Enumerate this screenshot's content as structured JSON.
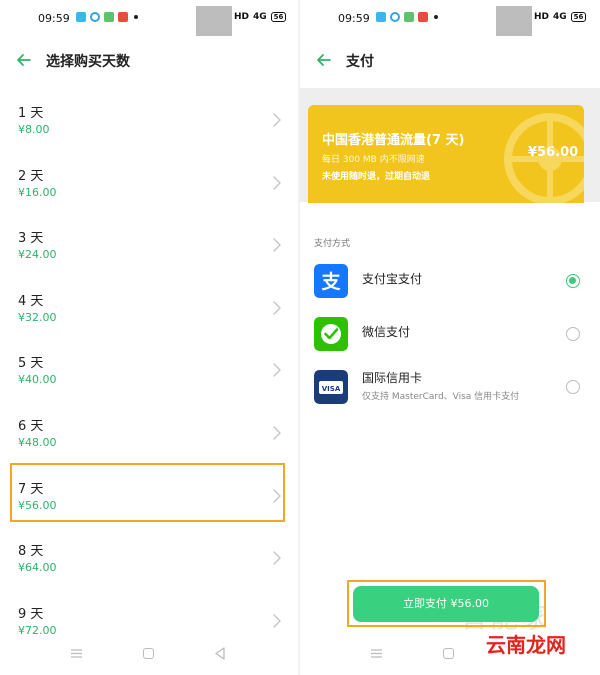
{
  "status_bar": {
    "time": "09:59",
    "hd": "HD",
    "signal": "4G",
    "battery": "56"
  },
  "left": {
    "title": "选择购买天数",
    "days": [
      {
        "label": "1 天",
        "price": "¥8.00"
      },
      {
        "label": "2 天",
        "price": "¥16.00"
      },
      {
        "label": "3 天",
        "price": "¥24.00"
      },
      {
        "label": "4 天",
        "price": "¥32.00"
      },
      {
        "label": "5 天",
        "price": "¥40.00"
      },
      {
        "label": "6 天",
        "price": "¥48.00"
      },
      {
        "label": "7 天",
        "price": "¥56.00"
      },
      {
        "label": "8 天",
        "price": "¥64.00"
      },
      {
        "label": "9 天",
        "price": "¥72.00"
      }
    ],
    "selected_index": 6
  },
  "right": {
    "title": "支付",
    "product": {
      "name": "中国香港普通流量(7 天)",
      "quota": "每日 300 MB 内不限网速",
      "note": "未使用随时退，过期自动退",
      "price": "¥56.00"
    },
    "section_label": "支付方式",
    "methods": [
      {
        "name": "支付宝支付",
        "desc": "",
        "selected": true
      },
      {
        "name": "微信支付",
        "desc": "",
        "selected": false
      },
      {
        "name": "国际信用卡",
        "desc": "仅支持 MasterCard、Visa 信用卡支付",
        "selected": false
      }
    ],
    "pay_button": "立即支付 ¥56.00"
  },
  "watermark": {
    "faint": "智能家",
    "logo": "云南龙网"
  },
  "colors": {
    "accent_green": "#2fb26a",
    "button_green": "#39d07f",
    "card_yellow": "#f2c41e",
    "highlight_orange": "#f5a623",
    "alipay_blue": "#1677ff",
    "wechat_green": "#2dc100",
    "visa_navy": "#1a3c7a"
  },
  "icons": [
    "back-arrow-icon",
    "chevron-right-icon",
    "alipay-icon",
    "wechat-pay-icon",
    "visa-card-icon",
    "nav-menu-icon",
    "nav-home-icon",
    "nav-back-icon"
  ]
}
